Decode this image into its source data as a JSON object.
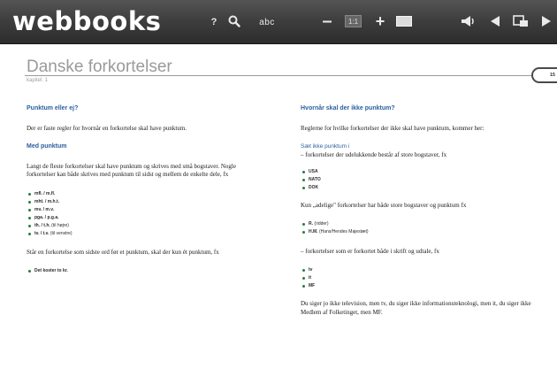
{
  "app": {
    "logo": "webbooks"
  },
  "toolbar": {
    "help_label": "?",
    "abc_label": "abc",
    "minus_label": "–",
    "zoom_label": "1:1",
    "plus_label": "+"
  },
  "icons": {
    "help": "question-mark-icon",
    "search": "search-icon",
    "abc": "abc-text-icon",
    "zoom_out": "minus-icon",
    "zoom_reset": "one-to-one-icon",
    "zoom_in": "plus-icon",
    "page_view": "page-view-icon",
    "audio": "speaker-icon",
    "prev": "arrow-left-icon",
    "layout": "layout-icon",
    "next": "arrow-right-icon"
  },
  "colors": {
    "toolbar": "#3f3f3f",
    "heading_blue": "#2b5fa0",
    "bullet_green": "#2b7a3d"
  },
  "document": {
    "title": "Danske forkortelser",
    "chapter": "kapitel: 1",
    "page_number": "15"
  },
  "left_column": {
    "heading_1": "Punktum eller ej?",
    "para_1": "Der er faste regler for hvornår en forkortelse skal have punktum.",
    "heading_2": "Med punktum",
    "para_2": "Langt de fleste forkortelser skal have punktum og skrives med små bogstaver. Nogle forkortelser kan både skrives med punktum til sidst og mellem de enkelte dele, fx",
    "list_1": [
      {
        "main": "mfl. / m.fl.",
        "sub": ""
      },
      {
        "main": "mht. / m.h.t.",
        "sub": ""
      },
      {
        "main": "mv. / m.v.",
        "sub": ""
      },
      {
        "main": "pga. / p.g.a.",
        "sub": ""
      },
      {
        "main": "th. / t.h.",
        "sub": " (til højre)"
      },
      {
        "main": "tv. / t.v.",
        "sub": " (til venstre)"
      }
    ],
    "para_3": "Står en forkortelse som sidste ord før et punktum, skal der kun ét punktum, fx",
    "list_2": [
      {
        "main": "Det koster to kr.",
        "sub": ""
      }
    ]
  },
  "right_column": {
    "heading_1": "Hvornår skal der ikke punktum?",
    "para_1": "Reglerne for hvilke forkortelser der ikke skal have punktum, kommer her:",
    "subheading": "Sæt ikke punktum i",
    "para_2": "– forkortelser der udelukkende består af store bogstaver, fx",
    "list_1": [
      {
        "main": "USA",
        "sub": ""
      },
      {
        "main": "NATO",
        "sub": ""
      },
      {
        "main": "DOK",
        "sub": ""
      }
    ],
    "para_3": "Kun „adelige\" forkortelser har både store bogstaver og punktum fx",
    "list_2": [
      {
        "main": "R.",
        "sub": " (ridder)"
      },
      {
        "main": "H.M.",
        "sub": " (Hans/Hendes Majestæt)"
      }
    ],
    "para_4": "– forkortelser som er forkortet både i skrift og udtale, fx",
    "list_3": [
      {
        "main": "tv",
        "sub": ""
      },
      {
        "main": "it",
        "sub": ""
      },
      {
        "main": "MF",
        "sub": ""
      }
    ],
    "para_5": "Du siger jo ikke television, men tv, du siger ikke informationsteknologi, men it, du siger ikke Medlem af Folketinget, men MF."
  }
}
